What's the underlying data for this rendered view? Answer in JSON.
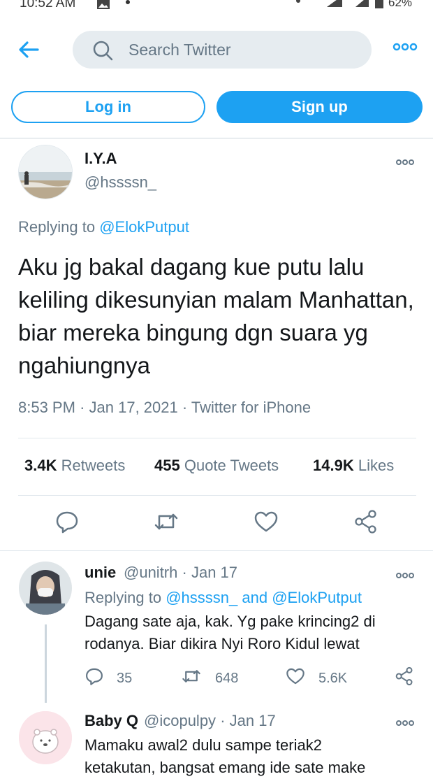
{
  "status_bar": {
    "time": "10:52 AM",
    "battery": "62%"
  },
  "search": {
    "placeholder": "Search Twitter"
  },
  "auth": {
    "login_label": "Log in",
    "signup_label": "Sign up"
  },
  "tweet": {
    "author_name": "I.Y.A",
    "author_handle": "@hssssn_",
    "replying_prefix": "Replying to",
    "replying_to": "@ElokPutput",
    "text": "Aku jg bakal dagang kue putu lalu keliling dikesunyian malam Manhattan, biar mereka bingung dgn suara yg ngahiungnya",
    "time": "8:53 PM",
    "date": "Jan 17, 2021",
    "source": "Twitter for iPhone",
    "retweets_count": "3.4K",
    "retweets_label": "Retweets",
    "quotes_count": "455",
    "quotes_label": "Quote Tweets",
    "likes_count": "14.9K",
    "likes_label": "Likes"
  },
  "replies": [
    {
      "name": "unie",
      "handle": "@unitrh",
      "date": "Jan 17",
      "replying_prefix": "Replying to",
      "replying_to_1": "@hssssn_",
      "replying_and": "and",
      "replying_to_2": "@ElokPutput",
      "text_line1": "Dagang sate aja, kak. Yg pake krincing2 di",
      "text_line2": "rodanya. Biar dikira Nyi Roro Kidul lewat",
      "reply_count": "35",
      "retweet_count": "648",
      "like_count": "5.6K"
    },
    {
      "name": "Baby Q",
      "handle": "@icopulpy",
      "date": "Jan 17",
      "text_line1": "Mamaku awal2 dulu sampe teriak2",
      "text_line2": "ketakutan, bangsat emang ide sate make"
    }
  ],
  "colors": {
    "accent": "#1da1f2",
    "secondary_text": "#657786",
    "primary_text": "#14171a",
    "search_bg": "#e6ecf0"
  },
  "icons": [
    "back-arrow-icon",
    "search-icon",
    "more-icon",
    "reply-icon",
    "retweet-icon",
    "like-icon",
    "share-icon"
  ]
}
